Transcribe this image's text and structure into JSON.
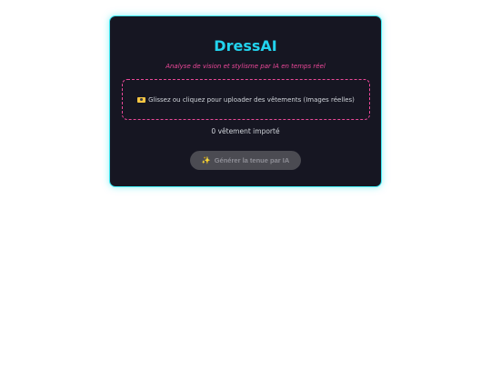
{
  "app": {
    "title": "DressAI",
    "subtitle": "Analyse de vision et stylisme par IA en temps réel"
  },
  "upload": {
    "label": "Glissez ou cliquez pour uploader des vêtements (Images réelles)",
    "icon": "camera-icon"
  },
  "status": {
    "count_text": "0 vêtement importé"
  },
  "actions": {
    "generate_label": "Générer la tenue par IA",
    "generate_icon": "sparkle-icon",
    "generate_enabled": false
  },
  "colors": {
    "accent": "#22d3ee",
    "secondary": "#ec4899",
    "card_background": "#161622",
    "button_background": "#4b4b52"
  }
}
